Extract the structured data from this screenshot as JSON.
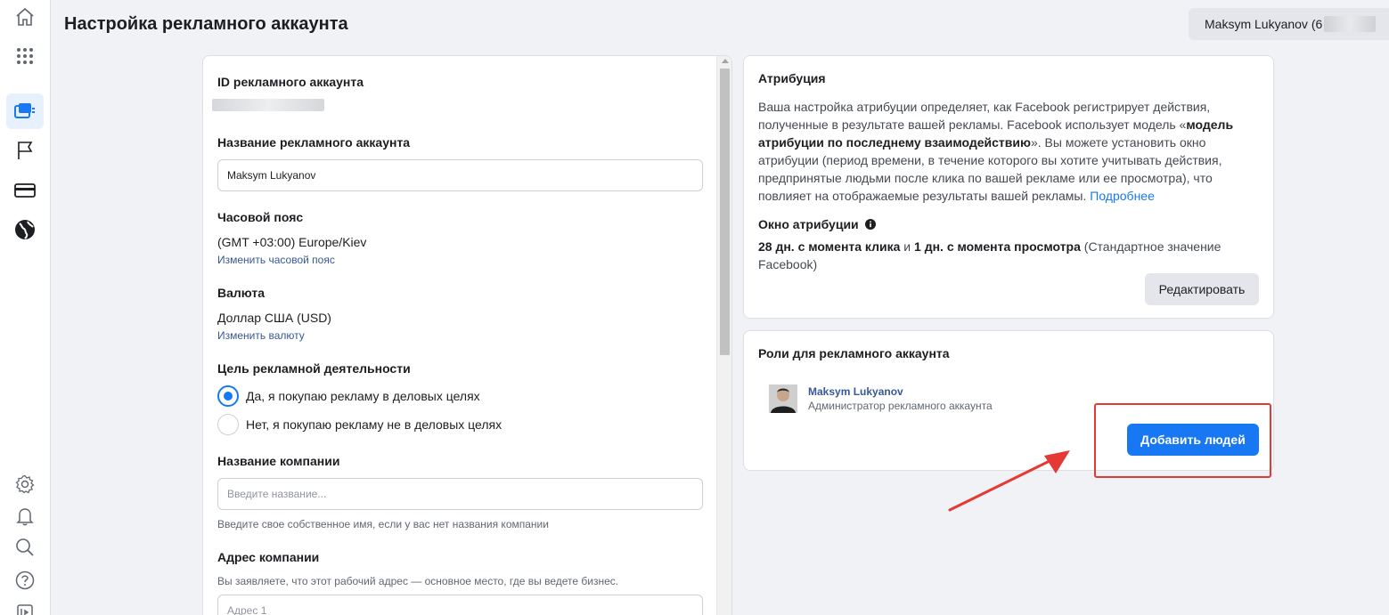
{
  "header": {
    "title": "Настройка рекламного аккаунта",
    "account_name": "Maksym Lukyanov (6"
  },
  "rail": {
    "icons": [
      "home-icon",
      "apps-grid-icon",
      "ads-manager-icon",
      "flag-icon",
      "billing-card-icon",
      "globe-icon",
      "settings-icon",
      "notifications-icon",
      "search-icon",
      "help-icon",
      "report-icon"
    ],
    "accent": "#1877f2"
  },
  "left": {
    "id_label": "ID рекламного аккаунта",
    "name_label": "Название рекламного аккаунта",
    "name_value": "Maksym Lukyanov",
    "timezone_label": "Часовой пояс",
    "timezone_value": "(GMT +03:00) Europe/Kiev",
    "timezone_link": "Изменить часовой пояс",
    "currency_label": "Валюта",
    "currency_value": "Доллар США (USD)",
    "currency_link": "Изменить валюту",
    "purpose_label": "Цель рекламной деятельности",
    "purpose_yes": "Да, я покупаю рекламу в деловых целях",
    "purpose_no": "Нет, я покупаю рекламу не в деловых целях",
    "company_label": "Название компании",
    "company_placeholder": "Введите название...",
    "company_hint": "Введите свое собственное имя, если у вас нет названия компании",
    "address_label": "Адрес компании",
    "address_hint": "Вы заявляете, что этот рабочий адрес — основное место, где вы ведете бизнес.",
    "address_placeholder": "Адрес 1"
  },
  "attribution": {
    "title": "Атрибуция",
    "para_1": "Ваша настройка атрибуции определяет, как Facebook регистрирует действия, полученные в результате вашей рекламы. Facebook использует модель «",
    "para_bold": "модель атрибуции по последнему взаимодействию",
    "para_2": "». Вы можете установить окно атрибуции (период времени, в течение которого вы хотите учитывать действия, предпринятые людьми после клика по вашей рекламе или ее просмотра), что повлияет на отображаемые результаты вашей рекламы.",
    "more_link": "Подробнее",
    "window_label": "Окно атрибуции",
    "window_bold_1": "28 дн. с момента клика",
    "window_and": " и ",
    "window_bold_2": "1 дн. с момента просмотра",
    "window_rest": " (Стандартное значение Facebook)",
    "edit_button": "Редактировать"
  },
  "roles": {
    "title": "Роли для рекламного аккаунта",
    "user_name": "Maksym Lukyanov",
    "user_role": "Администратор рекламного аккаунта",
    "add_button": "Добавить людей"
  },
  "annotation": {
    "color": "#e53935"
  }
}
